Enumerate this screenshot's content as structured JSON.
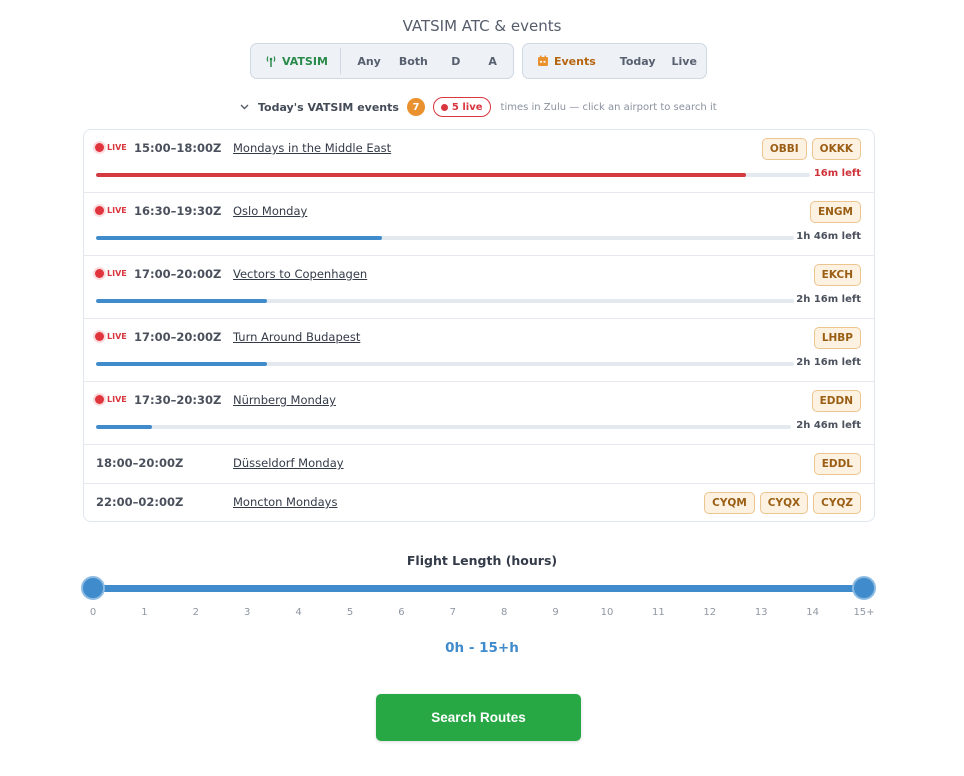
{
  "header": {
    "title": "VATSIM ATC & events"
  },
  "toolbar": {
    "vatsim_label": "VATSIM",
    "filters": [
      "Any",
      "Both",
      "D",
      "A"
    ],
    "events_label": "Events",
    "event_filters": [
      "Today",
      "Live"
    ]
  },
  "events_section": {
    "title": "Today's VATSIM events",
    "count": "7",
    "live_count": "5 live",
    "hint": "times in Zulu — click an airport to search it",
    "live_label": "LIVE",
    "events": [
      {
        "time": "15:00–18:00Z",
        "name": "Mondays in the Middle East",
        "airports": [
          "OBBI",
          "OKKK"
        ],
        "time_left": "16m left",
        "progress": 0.91,
        "live": true,
        "ending": true
      },
      {
        "time": "16:30–19:30Z",
        "name": "Oslo Monday",
        "airports": [
          "ENGM"
        ],
        "time_left": "1h 46m left",
        "progress": 0.41,
        "live": true
      },
      {
        "time": "17:00–20:00Z",
        "name": "Vectors to Copenhagen",
        "airports": [
          "EKCH"
        ],
        "time_left": "2h 16m left",
        "progress": 0.245,
        "live": true
      },
      {
        "time": "17:00–20:00Z",
        "name": "Turn Around Budapest",
        "airports": [
          "LHBP"
        ],
        "time_left": "2h 16m left",
        "progress": 0.245,
        "live": true
      },
      {
        "time": "17:30–20:30Z",
        "name": "Nürnberg Monday",
        "airports": [
          "EDDN"
        ],
        "time_left": "2h 46m left",
        "progress": 0.08,
        "live": true
      },
      {
        "time": "18:00–20:00Z",
        "name": "Düsseldorf Monday",
        "airports": [
          "EDDL"
        ],
        "live": false
      },
      {
        "time": "22:00–02:00Z",
        "name": "Moncton Mondays",
        "airports": [
          "CYQM",
          "CYQX",
          "CYQZ"
        ],
        "live": false
      }
    ]
  },
  "flight_length": {
    "title": "Flight Length (hours)",
    "ticks": [
      "0",
      "1",
      "2",
      "3",
      "4",
      "5",
      "6",
      "7",
      "8",
      "9",
      "10",
      "11",
      "12",
      "13",
      "14",
      "15+"
    ],
    "min_value": 0,
    "max_value": 15,
    "range_text": "0h - 15+h"
  },
  "search_button": {
    "label": "Search Routes"
  },
  "colors": {
    "accent": "#3f8bcb",
    "live": "#d9363e",
    "success": "#28a745",
    "badge": "#fdf2e2"
  }
}
